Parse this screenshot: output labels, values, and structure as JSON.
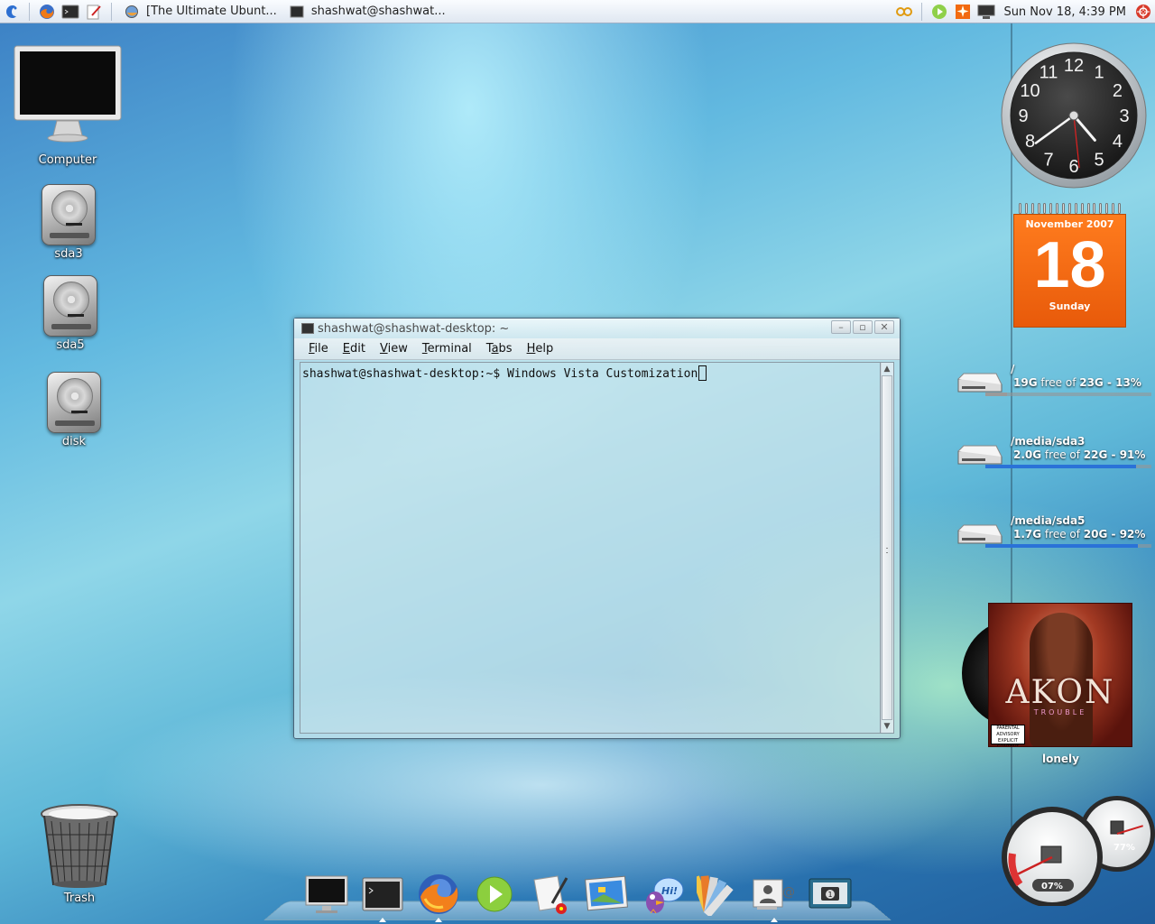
{
  "top_panel": {
    "tasks": [
      {
        "label": "[The Ultimate Ubunt..."
      },
      {
        "label": "shashwat@shashwat..."
      }
    ],
    "clock": "Sun Nov 18,  4:39 PM"
  },
  "desktop_icons": [
    {
      "label": "Computer"
    },
    {
      "label": "sda3"
    },
    {
      "label": "sda5"
    },
    {
      "label": "disk"
    }
  ],
  "trash": {
    "label": "Trash"
  },
  "terminal": {
    "title": "shashwat@shashwat-desktop: ~",
    "menu": [
      {
        "key": "F",
        "rest": "ile"
      },
      {
        "key": "E",
        "rest": "dit"
      },
      {
        "key": "V",
        "rest": "iew"
      },
      {
        "key": "T",
        "rest": "erminal"
      },
      {
        "key": "Ta",
        "rest": "bs",
        "underline_index": 1
      },
      {
        "key": "H",
        "rest": "elp"
      }
    ],
    "prompt": "shashwat@shashwat-desktop:~$ ",
    "command": "Windows Vista Customization"
  },
  "calendar": {
    "month_year": "November 2007",
    "day": "18",
    "weekday": "Sunday"
  },
  "analog_clock": {
    "numbers": [
      "12",
      "1",
      "2",
      "3",
      "4",
      "5",
      "6",
      "7",
      "8",
      "9",
      "10",
      "11"
    ],
    "time": {
      "hour": 4,
      "minute": 39,
      "second": 29
    }
  },
  "disks": [
    {
      "path": "/",
      "free": "19G",
      "mid": " free of ",
      "total": "23G",
      "percent": "13%",
      "used_fraction": 0.13,
      "bar_color": "#9a9a9a"
    },
    {
      "path": "/media/sda3",
      "free": "2.0G",
      "mid": " free of ",
      "total": "22G",
      "percent": "91%",
      "used_fraction": 0.91,
      "bar_color": "#2a72d8"
    },
    {
      "path": "/media/sda5",
      "free": "1.7G",
      "mid": " free of ",
      "total": "20G",
      "percent": "92%",
      "used_fraction": 0.92,
      "bar_color": "#2a72d8"
    }
  ],
  "now_playing": {
    "cover_title": "AKON",
    "cover_subtitle": "TROUBLE",
    "advisory": "PARENTAL ADVISORY EXPLICIT CONTENT",
    "track": "lonely"
  },
  "gauges": {
    "cpu_percent": "07%",
    "cpu_value": 0.07,
    "memory_percent": "77%",
    "memory_value": 0.77
  },
  "dock": {
    "items": [
      {
        "icon": "computer-icon",
        "running": false
      },
      {
        "icon": "terminal-icon",
        "running": true
      },
      {
        "icon": "firefox-icon",
        "running": true
      },
      {
        "icon": "media-player-icon",
        "running": false
      },
      {
        "icon": "text-editor-icon",
        "running": false
      },
      {
        "icon": "image-viewer-icon",
        "running": false
      },
      {
        "icon": "pidgin-icon",
        "running": false
      },
      {
        "icon": "color-palette-icon",
        "running": false
      },
      {
        "icon": "contacts-icon",
        "running": true
      },
      {
        "icon": "screenshot-icon",
        "running": false
      }
    ]
  }
}
